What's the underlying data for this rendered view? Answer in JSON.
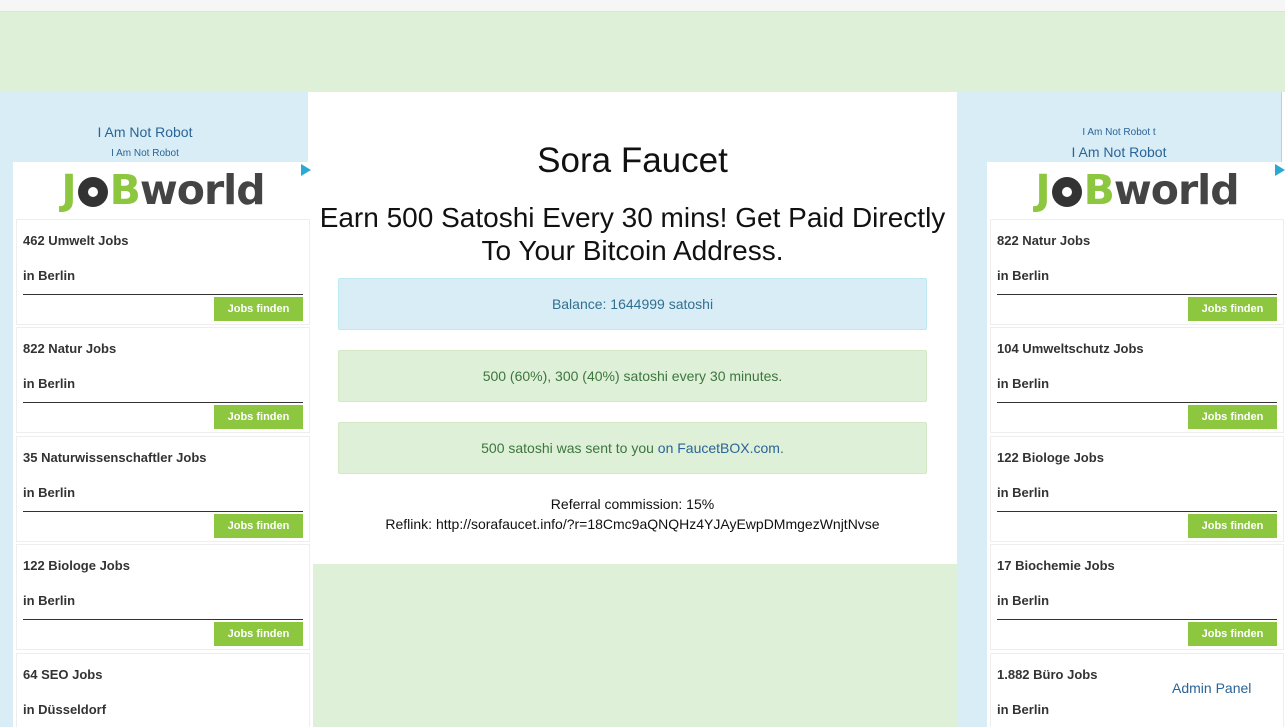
{
  "links": {
    "left_robot_1": "I Am Not Robot",
    "left_robot_2": "I Am Not Robot",
    "right_robot_1": "I Am Not Robot t",
    "right_robot_2": "I Am Not Robot",
    "admin_panel": "Admin Panel"
  },
  "main": {
    "title": "Sora Faucet",
    "subtitle": "Earn 500 Satoshi Every 30 mins! Get Paid Directly To Your Bitcoin Address.",
    "balance": "Balance: 1644999 satoshi",
    "rewards": "500 (60%), 300 (40%) satoshi every 30 minutes.",
    "sent_prefix": "500 satoshi was sent to you ",
    "sent_link": "on FaucetBOX.com",
    "sent_suffix": ".",
    "referral": "Referral commission: 15%",
    "reflink": "Reflink: http://sorafaucet.info/?r=18Cmc9aQNQHz4YJAyEwpDMmgezWnjtNvse"
  },
  "ads": {
    "logo": {
      "j": "J",
      "b": "B",
      "w": "world"
    },
    "button_label": "Jobs finden",
    "colors": {
      "accent": "#8dc63f",
      "dark": "#444444"
    },
    "left": [
      {
        "count": "462 Umwelt Jobs",
        "city": "in Berlin"
      },
      {
        "count": "822 Natur Jobs",
        "city": "in Berlin"
      },
      {
        "count": "35 Naturwissenschaftler Jobs",
        "city": "in Berlin"
      },
      {
        "count": "122 Biologe Jobs",
        "city": "in Berlin"
      },
      {
        "count": "64 SEO Jobs",
        "city": "in Düsseldorf"
      }
    ],
    "right": [
      {
        "count": "822 Natur Jobs",
        "city": "in Berlin"
      },
      {
        "count": "104 Umweltschutz Jobs",
        "city": "in Berlin"
      },
      {
        "count": "122 Biologe Jobs",
        "city": "in Berlin"
      },
      {
        "count": "17 Biochemie Jobs",
        "city": "in Berlin"
      },
      {
        "count": "1.882 Büro Jobs",
        "city": "in Berlin"
      }
    ]
  }
}
